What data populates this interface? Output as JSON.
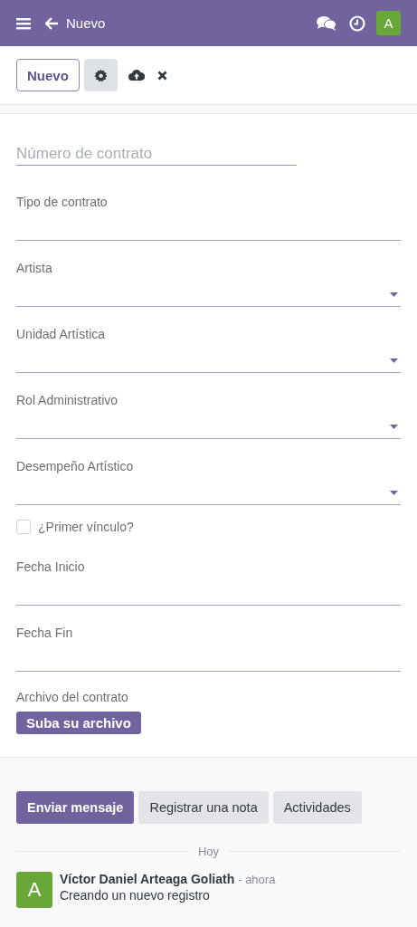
{
  "header": {
    "title": "Nuevo",
    "avatar": "A"
  },
  "toolbar": {
    "new_button": "Nuevo"
  },
  "form": {
    "contract_number": {
      "placeholder": "Número de contrato"
    },
    "fields": [
      {
        "kind": "text",
        "label": "Tipo de contrato"
      },
      {
        "kind": "select",
        "label": "Artista"
      },
      {
        "kind": "select",
        "label": "Unidad Artística"
      },
      {
        "kind": "select",
        "label": "Rol Administrativo"
      },
      {
        "kind": "select",
        "label": "Desempeño Artístico"
      },
      {
        "kind": "checkbox",
        "label": "¿Primer vínculo?",
        "checked": false
      },
      {
        "kind": "text",
        "label": "Fecha Inicio"
      },
      {
        "kind": "text",
        "label": "Fecha Fin"
      },
      {
        "kind": "file",
        "label": "Archivo del contrato",
        "button": "Suba su archivo"
      }
    ]
  },
  "chatter": {
    "tabs": [
      {
        "label": "Enviar mensaje",
        "selected": true
      },
      {
        "label": "Registrar una nota",
        "selected": false
      },
      {
        "label": "Actividades",
        "selected": false
      }
    ],
    "separator": "Hoy",
    "message": {
      "avatar": "A",
      "author": "Víctor Daniel Arteaga Goliath",
      "time": "- ahora",
      "body": "Creando un nuevo registro"
    }
  }
}
